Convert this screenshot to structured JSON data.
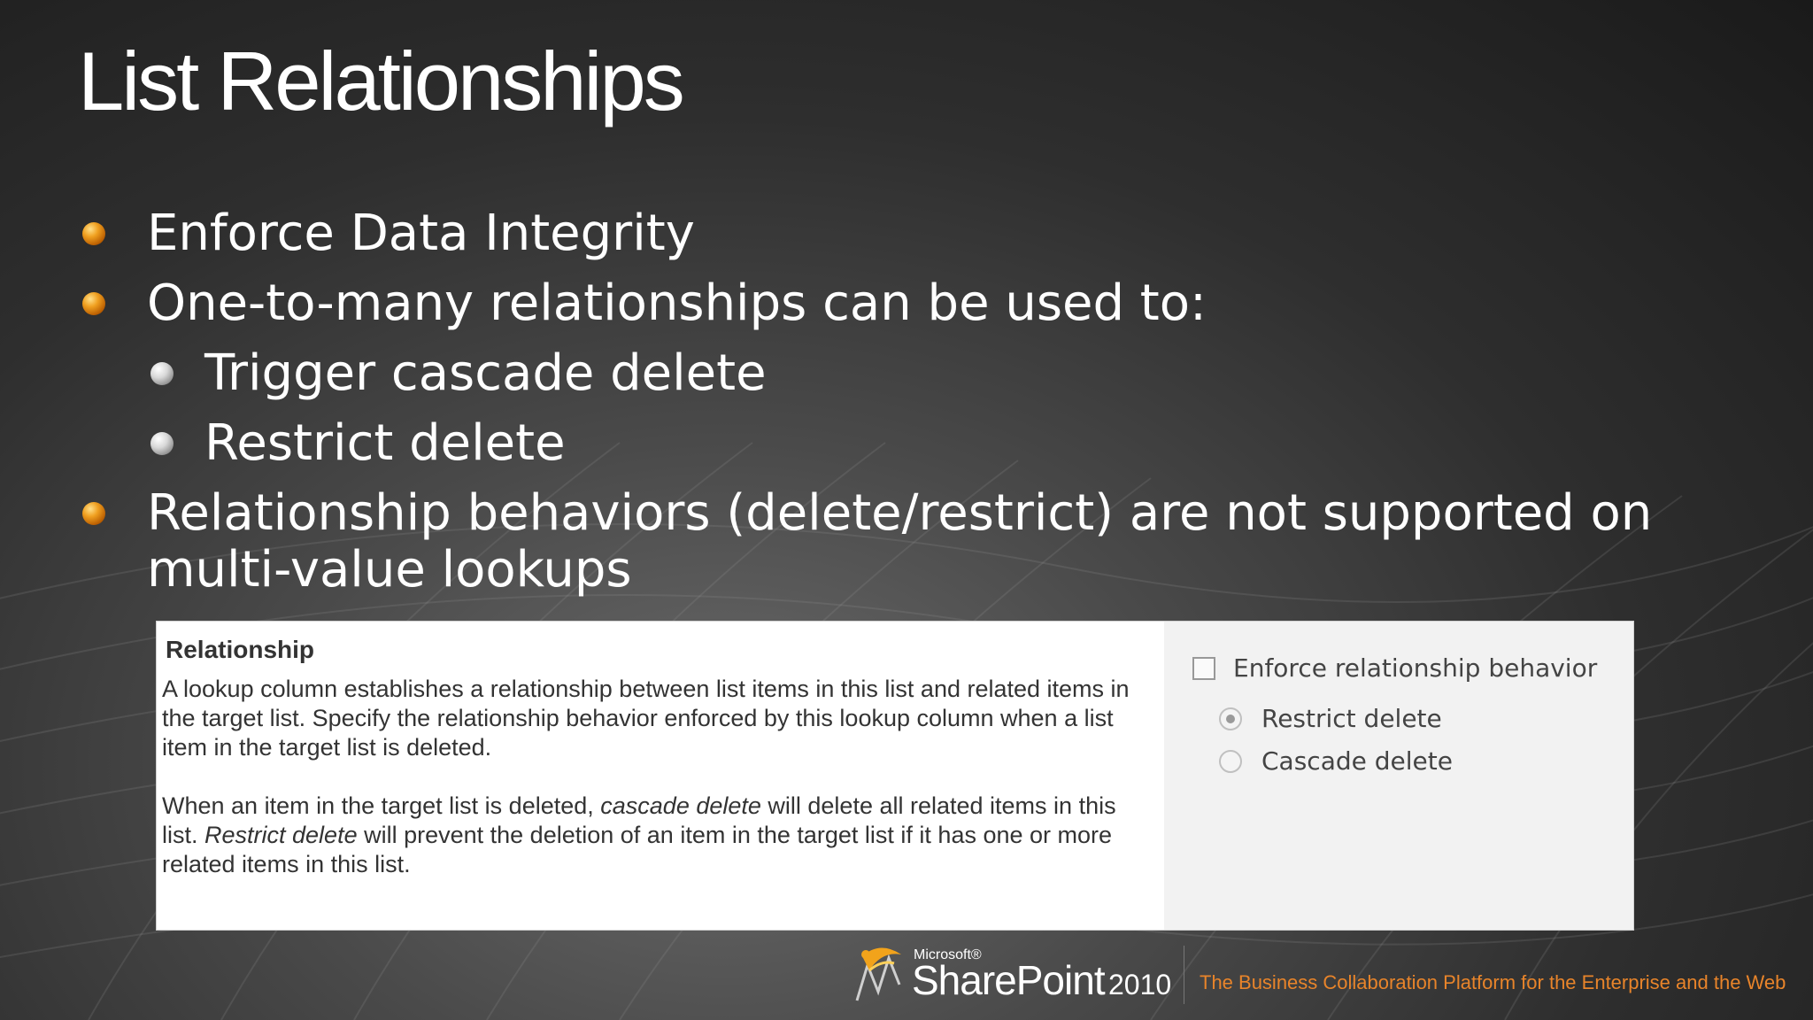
{
  "slide": {
    "title": "List Relationships",
    "bullets": [
      {
        "level": 1,
        "text": "Enforce Data Integrity"
      },
      {
        "level": 1,
        "text": "One-to-many relationships can be used to:"
      },
      {
        "level": 2,
        "text": "Trigger cascade delete"
      },
      {
        "level": 2,
        "text": "Restrict delete"
      },
      {
        "level": 1,
        "text": "Relationship behaviors (delete/restrict) are not supported on multi-value lookups"
      }
    ]
  },
  "relationship_panel": {
    "section_title": "Relationship",
    "description_1": "A lookup column establishes a relationship between list items in this list and related items in the target list. Specify the relationship behavior enforced by this lookup column when a list item in the target list is deleted.",
    "description_2": {
      "part1": "When an item in the target list is deleted, ",
      "cascade_term": "cascade delete",
      "part2": " will delete all related items in this list. ",
      "restrict_term": "Restrict delete",
      "part3": " will prevent the deletion of an item in the target list if it has one or more related items in this list."
    },
    "enforce_checkbox": {
      "label": "Enforce relationship behavior",
      "checked": false
    },
    "options": [
      {
        "label": "Restrict delete",
        "selected": true
      },
      {
        "label": "Cascade delete",
        "selected": false
      }
    ]
  },
  "footer": {
    "brand_small": "Microsoft®",
    "product": "SharePoint",
    "version": "2010",
    "tagline": "The Business Collaboration Platform for the Enterprise and the Web",
    "tagline_color": "#e8842a"
  }
}
